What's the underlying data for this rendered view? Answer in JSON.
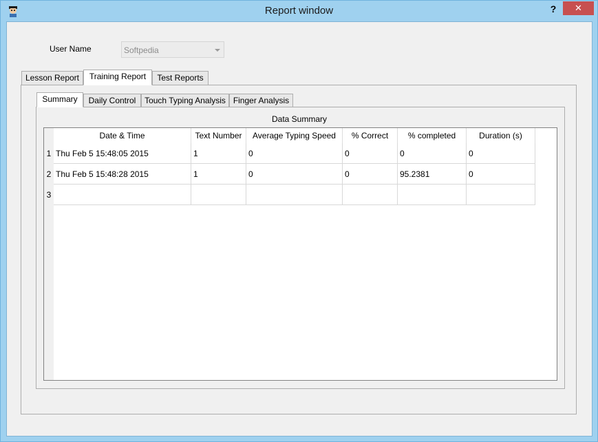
{
  "window": {
    "title": "Report window",
    "help_label": "?",
    "close_label": "✕",
    "icon": "typing-man-icon"
  },
  "user": {
    "label": "User Name",
    "value": "Softpedia"
  },
  "outer_tabs": [
    {
      "label": "Lesson Report",
      "active": false
    },
    {
      "label": "Training Report",
      "active": true
    },
    {
      "label": "Test Reports",
      "active": false
    }
  ],
  "inner_tabs": [
    {
      "label": "Summary",
      "active": true
    },
    {
      "label": "Daily Control",
      "active": false
    },
    {
      "label": "Touch Typing Analysis",
      "active": false
    },
    {
      "label": "Finger Analysis",
      "active": false
    }
  ],
  "summary": {
    "group_title": "Data Summary",
    "columns": [
      "Date & Time",
      "Text Number",
      "Average Typing Speed",
      "% Correct",
      "% completed",
      "Duration (s)"
    ],
    "rows": [
      {
        "num": "1",
        "cells": [
          "Thu Feb 5 15:48:05 2015",
          "1",
          "0",
          "0",
          "0",
          "0"
        ]
      },
      {
        "num": "2",
        "cells": [
          "Thu Feb 5 15:48:28 2015",
          "1",
          "0",
          "0",
          "95.2381",
          "0"
        ]
      },
      {
        "num": "3",
        "cells": [
          "",
          "",
          "",
          "",
          "",
          ""
        ]
      }
    ]
  }
}
